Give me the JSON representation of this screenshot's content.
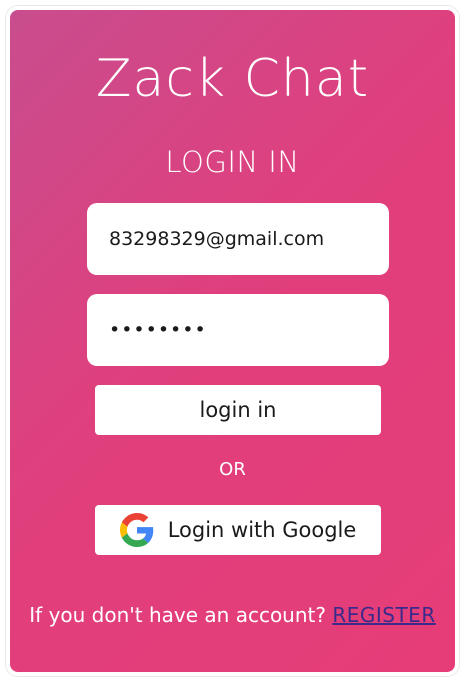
{
  "app": {
    "title": "Zack Chat"
  },
  "form": {
    "heading": "LOGIN IN",
    "email_value": "83298329@gmail.com",
    "password_value": "••••••••",
    "login_label": "login in",
    "or_label": "OR",
    "google_label": "Login with Google",
    "google_icon": "google-icon"
  },
  "footer": {
    "prompt": "If you don't have an account?",
    "register_label": "REGISTER"
  },
  "colors": {
    "background_gradient_start": "#c84d8e",
    "background_gradient_end": "#e63d78",
    "register_link": "#3b2a8a",
    "text": "#ffffff"
  }
}
